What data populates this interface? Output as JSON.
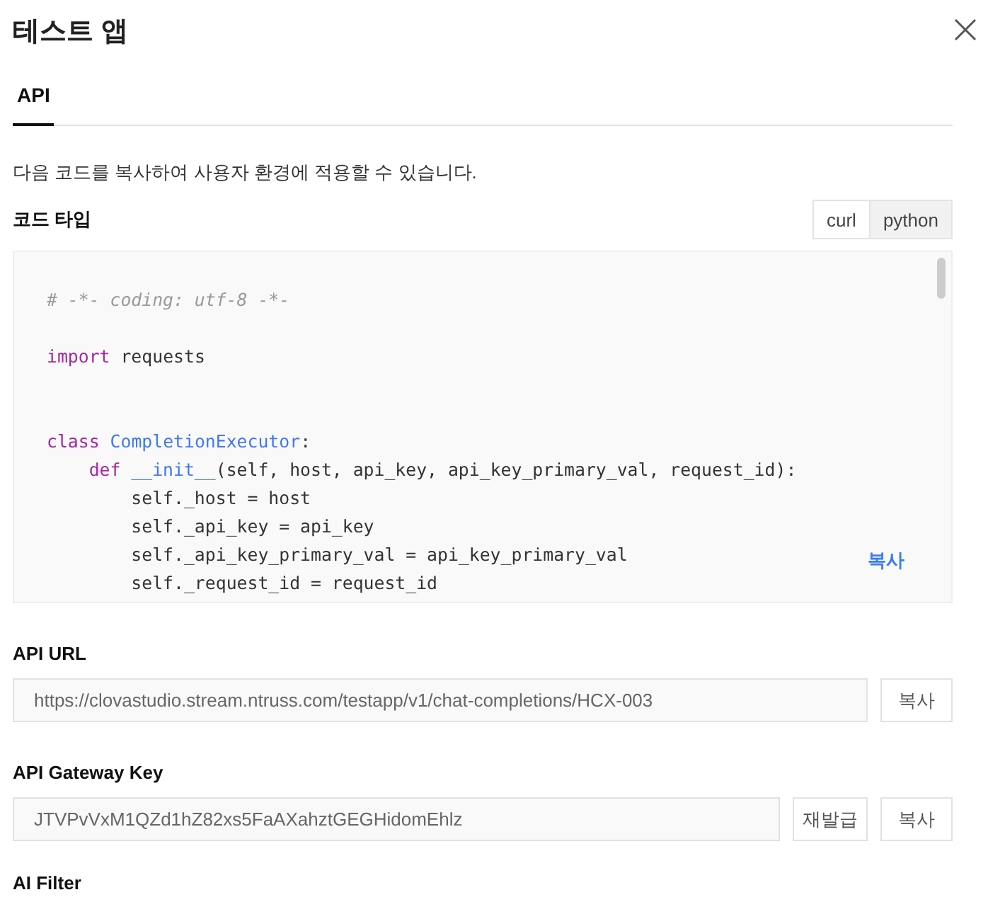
{
  "window": {
    "title": "테스트 앱"
  },
  "tabs": [
    {
      "label": "API",
      "selected": true
    }
  ],
  "description": "다음 코드를 복사하여 사용자 환경에 적용할 수 있습니다.",
  "code_type": {
    "label": "코드 타입",
    "options": [
      {
        "label": "curl",
        "selected": false
      },
      {
        "label": "python",
        "selected": true
      }
    ]
  },
  "code": {
    "copy_label": "복사",
    "lines": [
      {
        "kind": "code",
        "tokens": [
          {
            "kind": "comment",
            "text": "# -*- coding: utf-8 -*-"
          }
        ]
      },
      {
        "kind": "blank"
      },
      {
        "kind": "code",
        "tokens": [
          {
            "kind": "keyword",
            "text": "import"
          },
          {
            "kind": "plain",
            "text": " requests"
          }
        ]
      },
      {
        "kind": "blank"
      },
      {
        "kind": "blank"
      },
      {
        "kind": "code",
        "tokens": [
          {
            "kind": "keyword",
            "text": "class"
          },
          {
            "kind": "name",
            "text": " CompletionExecutor"
          },
          {
            "kind": "plain",
            "text": ":"
          }
        ]
      },
      {
        "kind": "code",
        "tokens": [
          {
            "kind": "keyword",
            "text": "    def"
          },
          {
            "kind": "name",
            "text": " __init__"
          },
          {
            "kind": "plain",
            "text": "(self, host, api_key, api_key_primary_val, request_id):"
          }
        ]
      },
      {
        "kind": "code",
        "tokens": [
          {
            "kind": "plain",
            "text": "        self._host = host"
          }
        ]
      },
      {
        "kind": "code",
        "tokens": [
          {
            "kind": "plain",
            "text": "        self._api_key = api_key"
          }
        ]
      },
      {
        "kind": "code",
        "tokens": [
          {
            "kind": "plain",
            "text": "        self._api_key_primary_val = api_key_primary_val"
          }
        ]
      },
      {
        "kind": "code",
        "tokens": [
          {
            "kind": "plain",
            "text": "        self._request_id = request_id"
          }
        ]
      }
    ]
  },
  "fields": [
    {
      "label": "API URL",
      "value": "https://clovastudio.stream.ntruss.com/testapp/v1/chat-completions/HCX-003",
      "buttons": [
        "복사"
      ]
    },
    {
      "label": "API Gateway Key",
      "value": "JTVPvVxM1QZd1hZ82xs5FaAXahztGEGHidomEhlz",
      "buttons": [
        "재발급",
        "복사"
      ]
    }
  ],
  "next_section": {
    "label": "AI Filter"
  }
}
